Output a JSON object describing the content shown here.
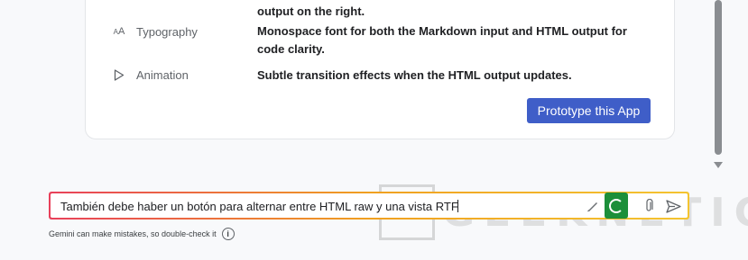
{
  "card": {
    "features": [
      {
        "icon": "list-icon",
        "name": "",
        "description": "output on the right."
      },
      {
        "icon": "typography-icon",
        "icon_glyph": "AA",
        "name": "Typography",
        "description": "Monospace font for both the Markdown input and HTML output for code clarity."
      },
      {
        "icon": "play-icon",
        "name": "Animation",
        "description": "Subtle transition effects when the HTML output updates."
      }
    ],
    "prototype_button": "Prototype this App"
  },
  "composer": {
    "value": "También debe haber un botón para alternar entre HTML raw y una vista RTF",
    "tools": [
      "brush-icon",
      "microphone-icon",
      "paperclip-icon",
      "send-icon"
    ]
  },
  "footer": {
    "disclaimer": "Gemini can make mistakes, so double-check it",
    "info_glyph": "i"
  },
  "watermark": {
    "text": "GEEKNETIC"
  },
  "colors": {
    "primary_button": "#3f5ec8",
    "mic_active": "#1c8f3a",
    "input_gradient_start": "#e8405a",
    "input_gradient_end": "#f4c430"
  }
}
